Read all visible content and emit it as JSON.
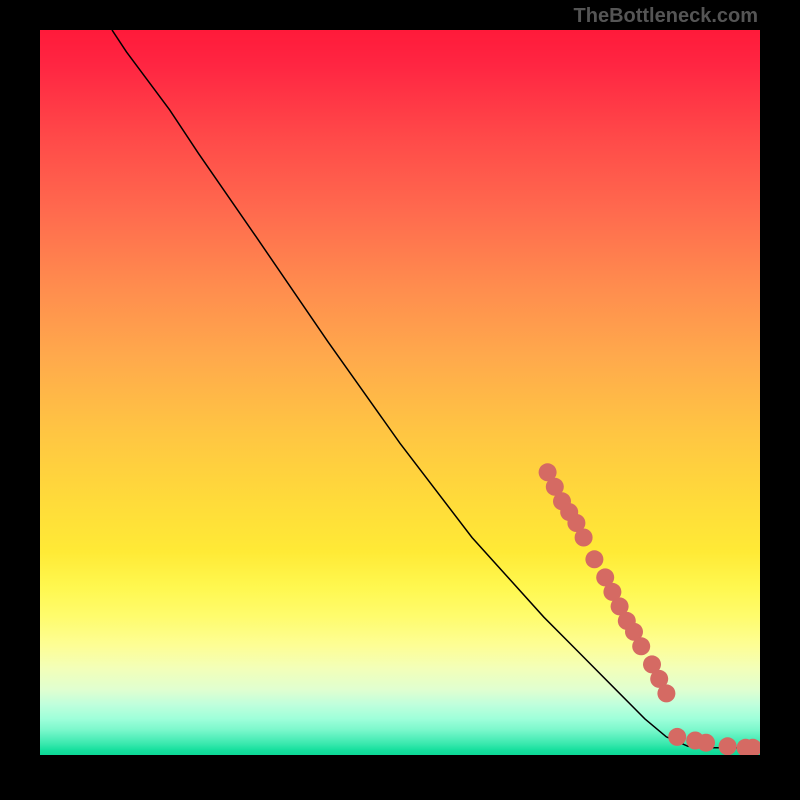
{
  "attribution": "TheBottleneck.com",
  "chart_data": {
    "type": "line",
    "title": "",
    "xlabel": "",
    "ylabel": "",
    "xlim": [
      0,
      100
    ],
    "ylim": [
      0,
      100
    ],
    "curve": [
      {
        "x": 10,
        "y": 100
      },
      {
        "x": 12,
        "y": 97
      },
      {
        "x": 15,
        "y": 93
      },
      {
        "x": 18,
        "y": 89
      },
      {
        "x": 22,
        "y": 83
      },
      {
        "x": 30,
        "y": 71.5
      },
      {
        "x": 40,
        "y": 57
      },
      {
        "x": 50,
        "y": 43
      },
      {
        "x": 60,
        "y": 30
      },
      {
        "x": 70,
        "y": 19
      },
      {
        "x": 75,
        "y": 14
      },
      {
        "x": 80,
        "y": 9
      },
      {
        "x": 84,
        "y": 5
      },
      {
        "x": 87,
        "y": 2.5
      },
      {
        "x": 90,
        "y": 1.2
      },
      {
        "x": 92,
        "y": 1
      },
      {
        "x": 95,
        "y": 1
      },
      {
        "x": 100,
        "y": 1
      }
    ],
    "scatter_points": [
      {
        "x": 70.5,
        "y": 39
      },
      {
        "x": 71.5,
        "y": 37
      },
      {
        "x": 72.5,
        "y": 35
      },
      {
        "x": 73.5,
        "y": 33.5
      },
      {
        "x": 74.5,
        "y": 32
      },
      {
        "x": 75.5,
        "y": 30
      },
      {
        "x": 77,
        "y": 27
      },
      {
        "x": 78.5,
        "y": 24.5
      },
      {
        "x": 79.5,
        "y": 22.5
      },
      {
        "x": 80.5,
        "y": 20.5
      },
      {
        "x": 81.5,
        "y": 18.5
      },
      {
        "x": 82.5,
        "y": 17
      },
      {
        "x": 83.5,
        "y": 15
      },
      {
        "x": 85,
        "y": 12.5
      },
      {
        "x": 86,
        "y": 10.5
      },
      {
        "x": 87,
        "y": 8.5
      },
      {
        "x": 88.5,
        "y": 2.5
      },
      {
        "x": 91,
        "y": 2
      },
      {
        "x": 92.5,
        "y": 1.7
      },
      {
        "x": 95.5,
        "y": 1.2
      },
      {
        "x": 98,
        "y": 1
      },
      {
        "x": 99,
        "y": 1
      }
    ]
  }
}
